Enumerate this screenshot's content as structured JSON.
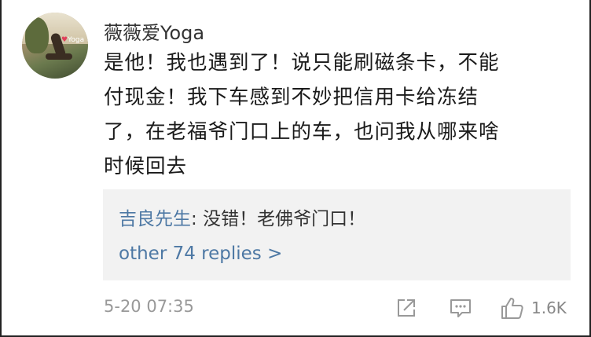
{
  "comment": {
    "username": "薇薇爱Yoga",
    "avatar_tag": "Yoga",
    "body_lines": [
      "是他！我也遇到了！说只能刷磁条卡，不能",
      "付现金！我下车感到不妙把信用卡给冻结",
      "了，在老福爷门口上的车，也问我从哪来啥",
      "时候回去"
    ],
    "timestamp": "5-20 07:35",
    "like_count": "1.6K"
  },
  "reply": {
    "author": "吉良先生",
    "separator": ": ",
    "text": "没错！老佛爷门口！",
    "more_label": "other 74 replies >"
  },
  "icons": {
    "share": "share-icon",
    "comment": "comment-icon",
    "like": "thumbs-up-icon"
  },
  "colors": {
    "link": "#4d78a4",
    "muted": "#999999",
    "reply_bg": "#f2f2f2"
  }
}
